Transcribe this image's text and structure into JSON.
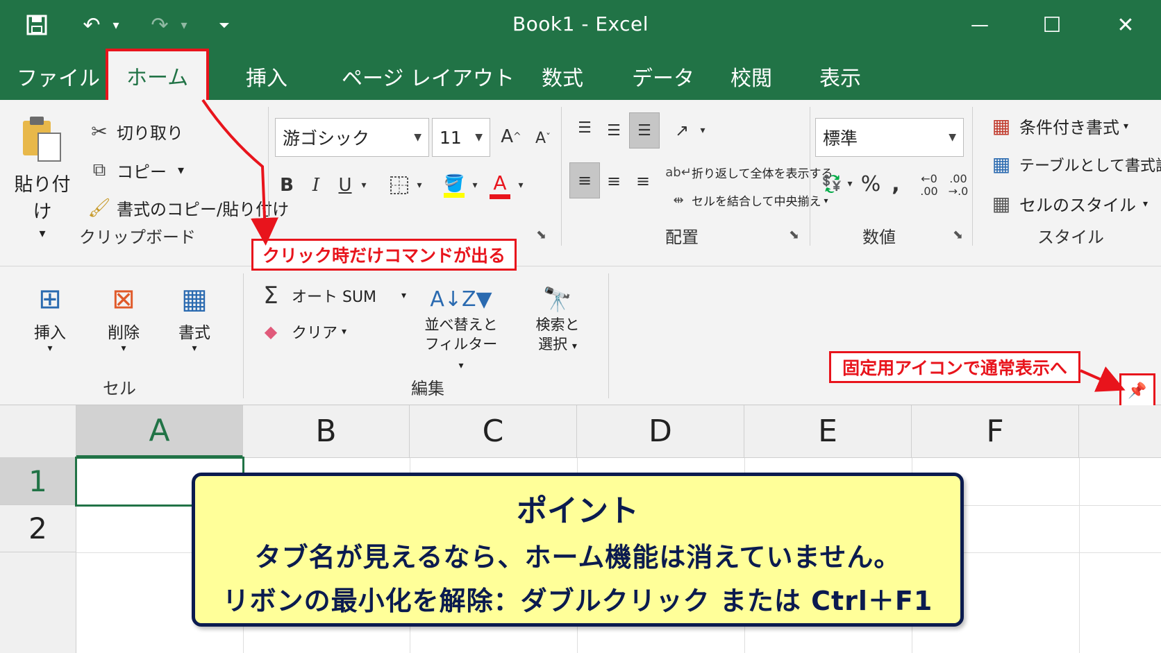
{
  "window": {
    "title": "Book1  -  Excel",
    "minimize": "—",
    "maximize": "☐",
    "close": "✕"
  },
  "qat": {
    "save": "💾",
    "undo": "↶",
    "redo": "↷",
    "dropdown": "▾",
    "customize": "⏷"
  },
  "tabs": [
    "ファイル",
    "ホーム",
    "挿入",
    "ページ レイアウト",
    "数式",
    "データ",
    "校閲",
    "表示"
  ],
  "active_tab": "ホーム",
  "clipboard": {
    "paste": "貼り付け",
    "cut": "切り取り",
    "copy": "コピー",
    "format_painter": "書式のコピー/貼り付け",
    "group": "クリップボード"
  },
  "font": {
    "name": "游ゴシック",
    "size": "11",
    "grow": "A",
    "shrink": "A",
    "bold": "B",
    "italic": "I",
    "underline": "U"
  },
  "alignment": {
    "wrap": "折り返して全体を表示する",
    "merge": "セルを結合して中央揃え",
    "group": "配置"
  },
  "number": {
    "format": "標準",
    "percent": "%",
    "comma": ",",
    "inc_decimal_a": "←0",
    "inc_decimal_b": ".00",
    "dec_decimal_a": ".00",
    "dec_decimal_b": "→.0",
    "group": "数値"
  },
  "styles": {
    "conditional": "条件付き書式",
    "table": "テーブルとして書式設定",
    "cell": "セルのスタイル",
    "group": "スタイル"
  },
  "cells": {
    "insert": "挿入",
    "delete": "削除",
    "format": "書式",
    "group": "セル"
  },
  "editing": {
    "autosum": "オート SUM",
    "clear": "クリア",
    "sort_line1": "並べ替えと",
    "sort_line2": "フィルター",
    "find_line1": "検索と",
    "find_line2": "選択",
    "group": "編集"
  },
  "callouts": {
    "click": "クリック時だけコマンドが出る",
    "pin": "固定用アイコンで通常表示へ"
  },
  "sheet": {
    "columns": [
      "A",
      "B",
      "C",
      "D",
      "E",
      "F"
    ],
    "rows": [
      "1",
      "2"
    ]
  },
  "point": {
    "title": "ポイント",
    "line1": "タブ名が見えるなら、ホーム機能は消えていません。",
    "line2": "リボンの最小化を解除：ダブルクリック または Ctrl＋F1"
  },
  "colors": {
    "excel_green": "#217346",
    "callout_red": "#e8141c",
    "point_bg": "#ffff99",
    "point_text": "#0b1b4f"
  }
}
